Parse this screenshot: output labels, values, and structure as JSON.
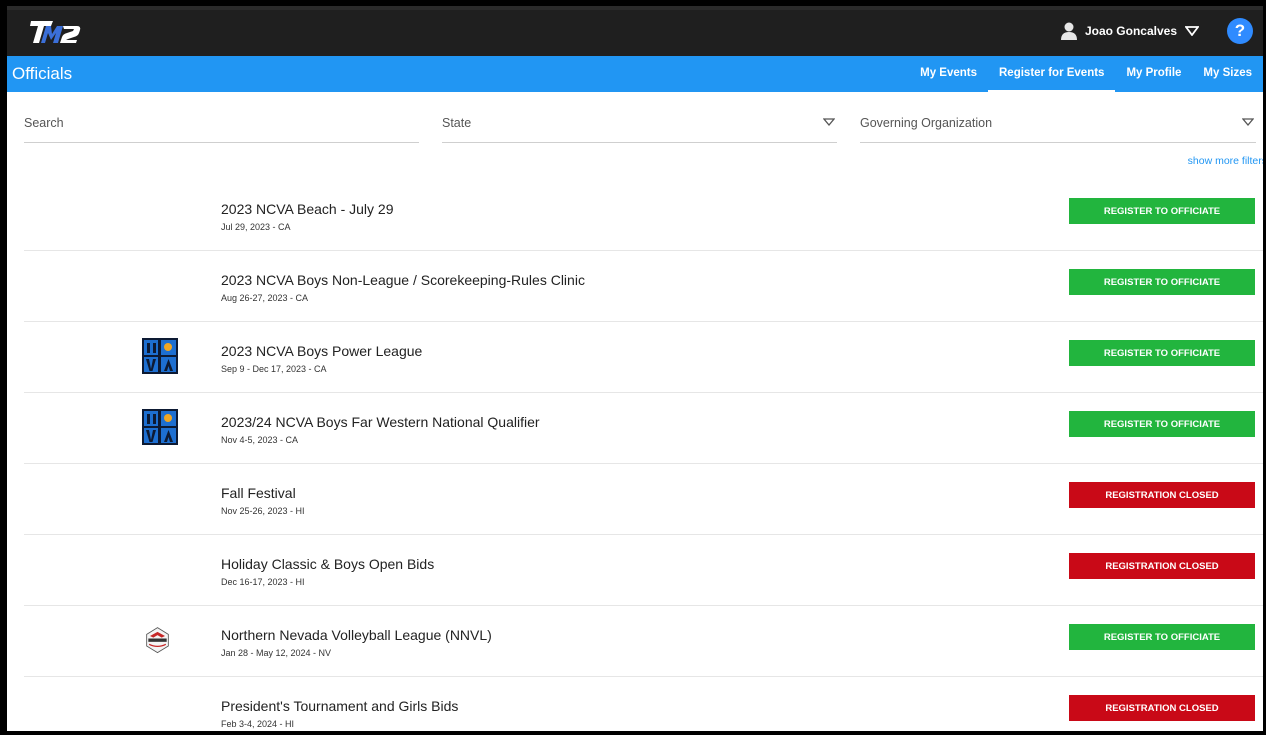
{
  "header": {
    "user_name": "Joao Goncalves",
    "help_label": "?"
  },
  "nav": {
    "title": "Officials",
    "links": [
      {
        "label": "My Events",
        "active": false
      },
      {
        "label": "Register for Events",
        "active": true
      },
      {
        "label": "My Profile",
        "active": false
      },
      {
        "label": "My Sizes",
        "active": false
      }
    ]
  },
  "filters": {
    "search_label": "Search",
    "state_label": "State",
    "org_label": "Governing Organization",
    "show_more": "show more filters"
  },
  "colors": {
    "register": "#22b53e",
    "closed": "#c90917",
    "nav": "#2196f3",
    "topbar": "#1f1f1f"
  },
  "events": [
    {
      "name": "2023 NCVA Beach - July 29",
      "date": "Jul 29, 2023 - CA",
      "logo": "",
      "button": "REGISTER TO OFFICIATE",
      "status": "open"
    },
    {
      "name": "2023 NCVA Boys Non-League / Scorekeeping-Rules Clinic",
      "date": "Aug 26-27, 2023 - CA",
      "logo": "",
      "button": "REGISTER TO OFFICIATE",
      "status": "open"
    },
    {
      "name": "2023 NCVA Boys Power League",
      "date": "Sep 9 - Dec 17, 2023 - CA",
      "logo": "ncva-logo",
      "button": "REGISTER TO OFFICIATE",
      "status": "open"
    },
    {
      "name": "2023/24 NCVA Boys Far Western National Qualifier",
      "date": "Nov 4-5, 2023 - CA",
      "logo": "ncva-logo",
      "button": "REGISTER TO OFFICIATE",
      "status": "open"
    },
    {
      "name": "Fall Festival",
      "date": "Nov 25-26, 2023 - HI",
      "logo": "",
      "button": "REGISTRATION CLOSED",
      "status": "closed"
    },
    {
      "name": "Holiday Classic & Boys Open Bids",
      "date": "Dec 16-17, 2023 - HI",
      "logo": "",
      "button": "REGISTRATION CLOSED",
      "status": "closed"
    },
    {
      "name": "Northern Nevada Volleyball League (NNVL)",
      "date": "Jan 28 - May 12, 2024 - NV",
      "logo": "nnvl-logo",
      "button": "REGISTER TO OFFICIATE",
      "status": "open"
    },
    {
      "name": "President's Tournament and Girls Bids",
      "date": "Feb 3-4, 2024 - HI",
      "logo": "",
      "button": "REGISTRATION CLOSED",
      "status": "closed"
    }
  ]
}
